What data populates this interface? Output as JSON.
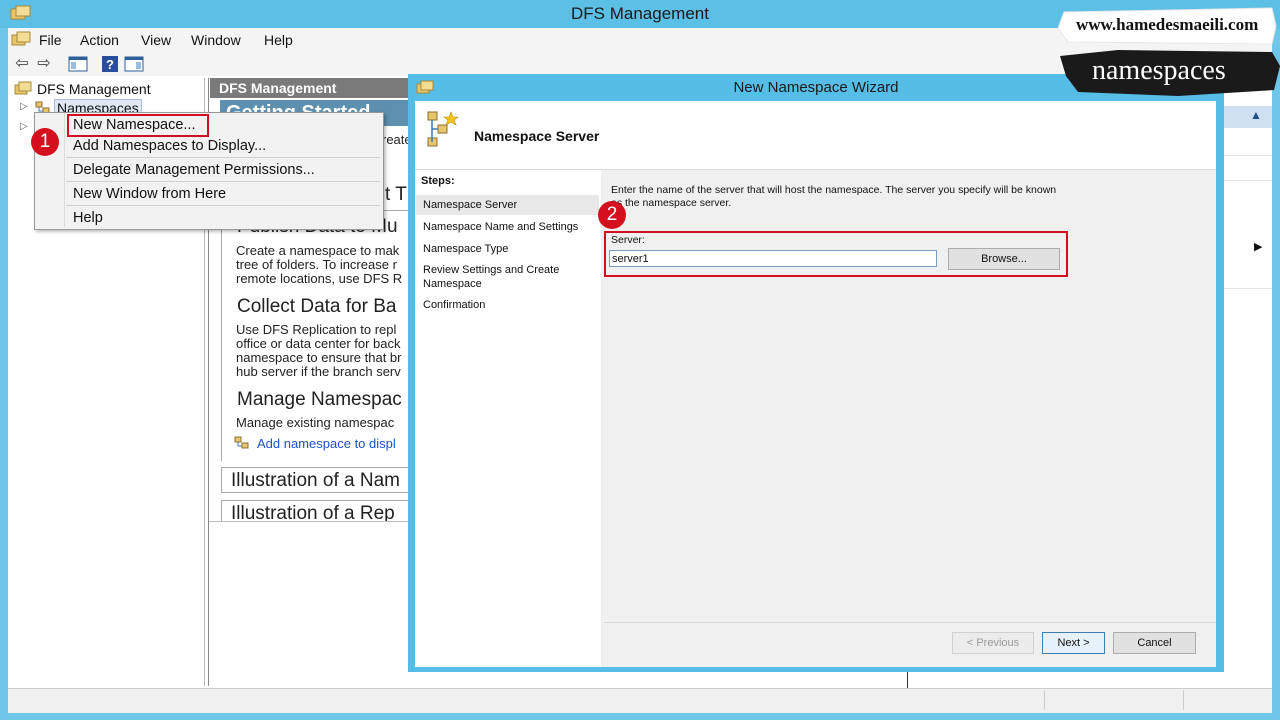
{
  "window": {
    "title": "DFS Management"
  },
  "menubar": {
    "items": [
      "File",
      "Action",
      "View",
      "Window",
      "Help"
    ]
  },
  "tree": {
    "root": "DFS Management",
    "namespaces": "Namespaces"
  },
  "results": {
    "header": "DFS Management",
    "getting_started": "Getting Started",
    "frag_create": "reate",
    "frag_t": "t T",
    "publish_head": "Publish Data to Mu",
    "publish_text": [
      "Create a namespace to mak",
      "tree of folders. To increase r",
      "remote locations, use DFS R"
    ],
    "collect_head": "Collect Data for Ba",
    "collect_text": [
      "Use DFS Replication to repl",
      "office or data center for back",
      "namespace to ensure that br",
      "hub server if the branch serv"
    ],
    "manage_head": "Manage Namespac",
    "manage_text": "Manage existing namespac",
    "add_link": "Add namespace to displ",
    "illus1": "Illustration of a Nam",
    "illus2": "Illustration of a Rep"
  },
  "context_menu": {
    "items": [
      "New Namespace...",
      "Add Namespaces to Display...",
      "Delegate Management Permissions...",
      "New Window from Here",
      "Help"
    ]
  },
  "badges": {
    "one": "1",
    "two": "2"
  },
  "wizard": {
    "title": "New Namespace Wizard",
    "header_title": "Namespace Server",
    "steps_label": "Steps:",
    "steps": [
      "Namespace Server",
      "Namespace Name and Settings",
      "Namespace Type",
      "Review Settings and Create Namespace",
      "Confirmation"
    ],
    "description": "Enter the name of the server that will host the namespace. The server you specify will be known as the namespace server.",
    "server_label": "Server:",
    "server_value": "server1",
    "browse_label": "Browse...",
    "prev_label": "< Previous",
    "next_label": "Next >",
    "cancel_label": "Cancel"
  },
  "watermark": {
    "site": "www.hamedesmaeili.com",
    "topic": "namespaces"
  },
  "colors": {
    "titlebar": "#5bbfe6",
    "highlight_red": "#d0101f",
    "banner": "#1a1a1a"
  }
}
